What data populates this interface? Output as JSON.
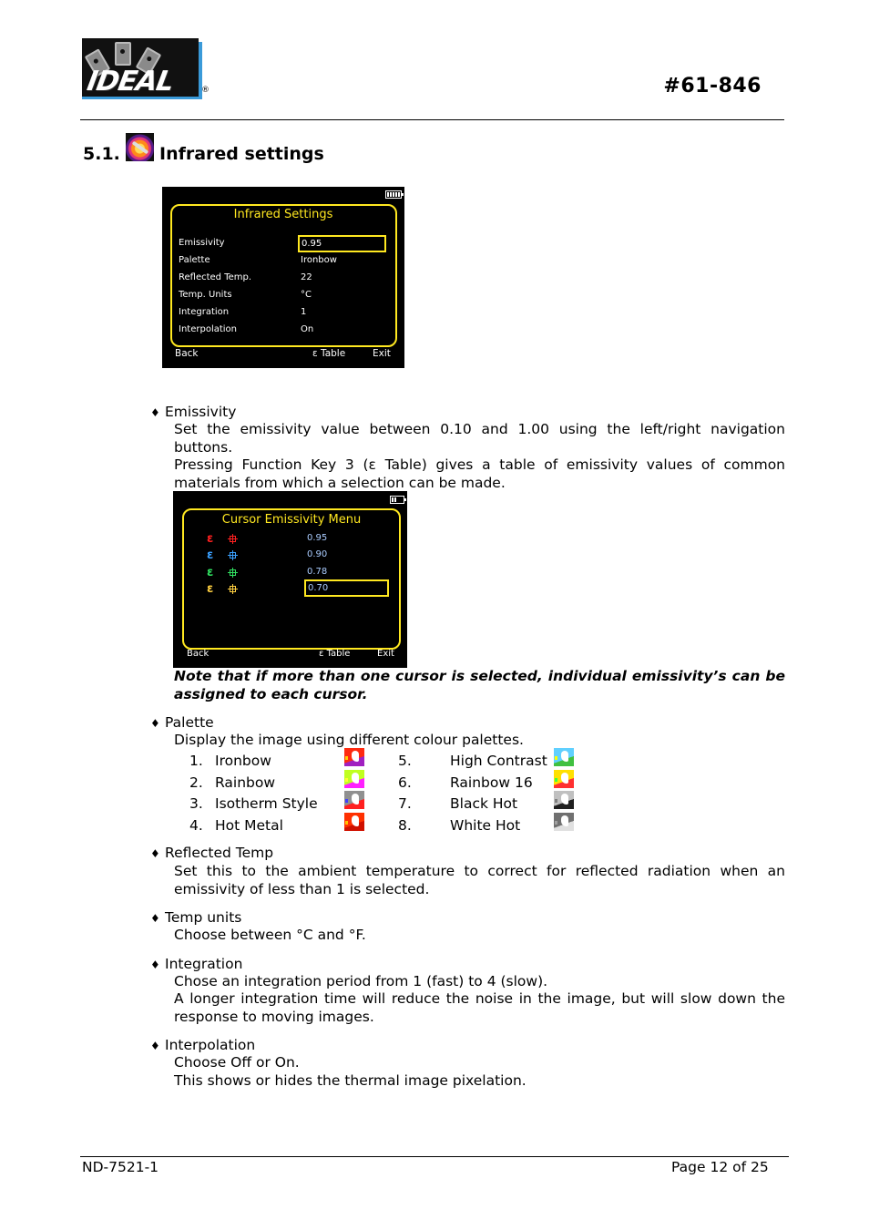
{
  "header": {
    "logo_text": "IDEAL",
    "registered_mark": "®",
    "doc_number": "#61-846"
  },
  "section": {
    "number": "5.1.",
    "icon": "infrared-settings-icon",
    "title": "Infrared settings"
  },
  "screen1": {
    "title": "Infrared Settings",
    "battery_icon": "battery-full-icon",
    "rows": [
      {
        "label": "Emissivity",
        "value": "0.95",
        "selected": true
      },
      {
        "label": "Palette",
        "value": "Ironbow",
        "selected": false
      },
      {
        "label": "Reflected Temp.",
        "value": "22",
        "selected": false
      },
      {
        "label": "Temp. Units",
        "value": "°C",
        "selected": false
      },
      {
        "label": "Integration",
        "value": "1",
        "selected": false
      },
      {
        "label": "Interpolation",
        "value": "On",
        "selected": false
      }
    ],
    "softkeys": {
      "left": "Back",
      "middle": "ε Table",
      "right": "Exit"
    }
  },
  "screen2": {
    "title": "Cursor Emissivity Menu",
    "battery_icon": "battery-low-icon",
    "cursors": [
      {
        "symbol": "ε",
        "color": "#ff2020",
        "value": "0.95",
        "selected": false
      },
      {
        "symbol": "ε",
        "color": "#3aa0ff",
        "value": "0.90",
        "selected": false
      },
      {
        "symbol": "ε",
        "color": "#30e060",
        "value": "0.78",
        "selected": false
      },
      {
        "symbol": "ε",
        "color": "#ffd040",
        "value": "0.70",
        "selected": true
      }
    ],
    "softkeys": {
      "left": "Back",
      "middle": "ε Table",
      "right": "Exit"
    }
  },
  "bullets": {
    "emissivity": {
      "label": "Emissivity",
      "p1": "Set the emissivity value between 0.10 and 1.00 using the left/right navigation buttons.",
      "p2": "Pressing Function Key 3 (ε Table) gives a table of emissivity values of common materials from which a selection can be made.",
      "note": "Note that if more than one cursor is selected, individual emissivity’s can be assigned to each cursor."
    },
    "palette": {
      "label": "Palette",
      "p1": "Display the image using different colour palettes.",
      "items": [
        {
          "num": "1.",
          "name": "Ironbow",
          "colors": [
            "#ff2a10",
            "#a020c0",
            "#ffffff",
            "#ffd000"
          ]
        },
        {
          "num": "2.",
          "name": "Rainbow",
          "colors": [
            "#c0ff20",
            "#ff20ff",
            "#ffffff",
            "#ffff30"
          ]
        },
        {
          "num": "3.",
          "name": "Isotherm Style",
          "colors": [
            "#909090",
            "#ff2020",
            "#ffffff",
            "#4040ff"
          ]
        },
        {
          "num": "4.",
          "name": "Hot Metal",
          "colors": [
            "#ff3000",
            "#d01000",
            "#ffffff",
            "#ffc000"
          ]
        },
        {
          "num": "5.",
          "name": "High Contrast",
          "colors": [
            "#60d0ff",
            "#40c040",
            "#ffffff",
            "#ffff00"
          ]
        },
        {
          "num": "6.",
          "name": "Rainbow 16",
          "colors": [
            "#ffe000",
            "#ff3030",
            "#ffffff",
            "#40ff40"
          ]
        },
        {
          "num": "7.",
          "name": "Black Hot",
          "colors": [
            "#c0c0c0",
            "#202020",
            "#ffffff",
            "#808080"
          ]
        },
        {
          "num": "8.",
          "name": "White Hot",
          "colors": [
            "#707070",
            "#e0e0e0",
            "#ffffff",
            "#a0a0a0"
          ]
        }
      ]
    },
    "reflected": {
      "label": "Reflected Temp",
      "p1": "Set this to the ambient temperature to correct for reflected radiation when an emissivity of less than 1 is selected."
    },
    "temp_units": {
      "label": "Temp units",
      "p1": "Choose between °C and °F."
    },
    "integration": {
      "label": "Integration",
      "p1": "Chose an integration period from 1 (fast) to 4 (slow).",
      "p2": "A longer integration time will reduce the noise in the image, but will slow down the response to moving images."
    },
    "interpolation": {
      "label": "Interpolation",
      "p1": "Choose Off or On.",
      "p2": "This shows or hides the thermal image pixelation."
    }
  },
  "footer": {
    "doc_id": "ND-7521-1",
    "page": "Page 12 of 25"
  }
}
